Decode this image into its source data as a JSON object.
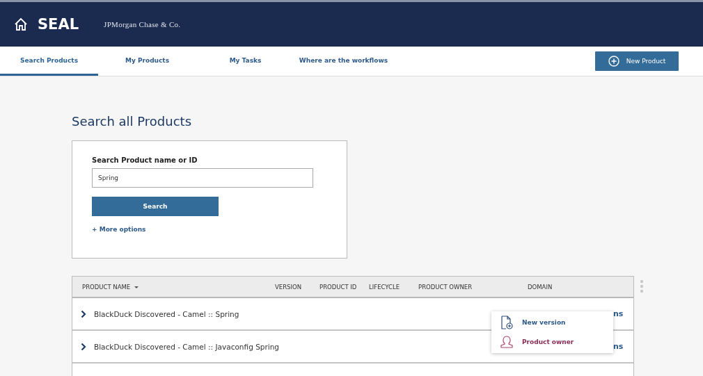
{
  "header": {
    "app_name": "SEAL",
    "company": "JPMorgan Chase & Co."
  },
  "tabs": [
    {
      "label": "Search Products",
      "selected": true
    },
    {
      "label": "My Products",
      "selected": false
    },
    {
      "label": "My Tasks",
      "selected": false
    },
    {
      "label": "Where are the workflows",
      "selected": false
    }
  ],
  "new_product_button": "New Product",
  "page_title": "Search all Products",
  "search": {
    "label": "Search Product name or ID",
    "value": "Spring",
    "button": "Search",
    "more_options": "+ More options"
  },
  "table": {
    "columns": [
      {
        "label": "PRODUCT NAME",
        "sorted": true
      },
      {
        "label": "VERSION",
        "sorted": false
      },
      {
        "label": "PRODUCT ID",
        "sorted": false
      },
      {
        "label": "LIFECYCLE",
        "sorted": false
      },
      {
        "label": "PRODUCT OWNER",
        "sorted": false
      },
      {
        "label": "DOMAIN",
        "sorted": false
      }
    ],
    "rows": [
      {
        "name": "BlackDuck Discovered - Camel :: Spring",
        "actions": "ns"
      },
      {
        "name": "BlackDuck Discovered - Camel :: Javaconfig Spring",
        "actions": "ns"
      }
    ]
  },
  "actions_menu": [
    {
      "kind": "version",
      "label": "New version"
    },
    {
      "kind": "owner",
      "label": "Product owner"
    }
  ]
}
